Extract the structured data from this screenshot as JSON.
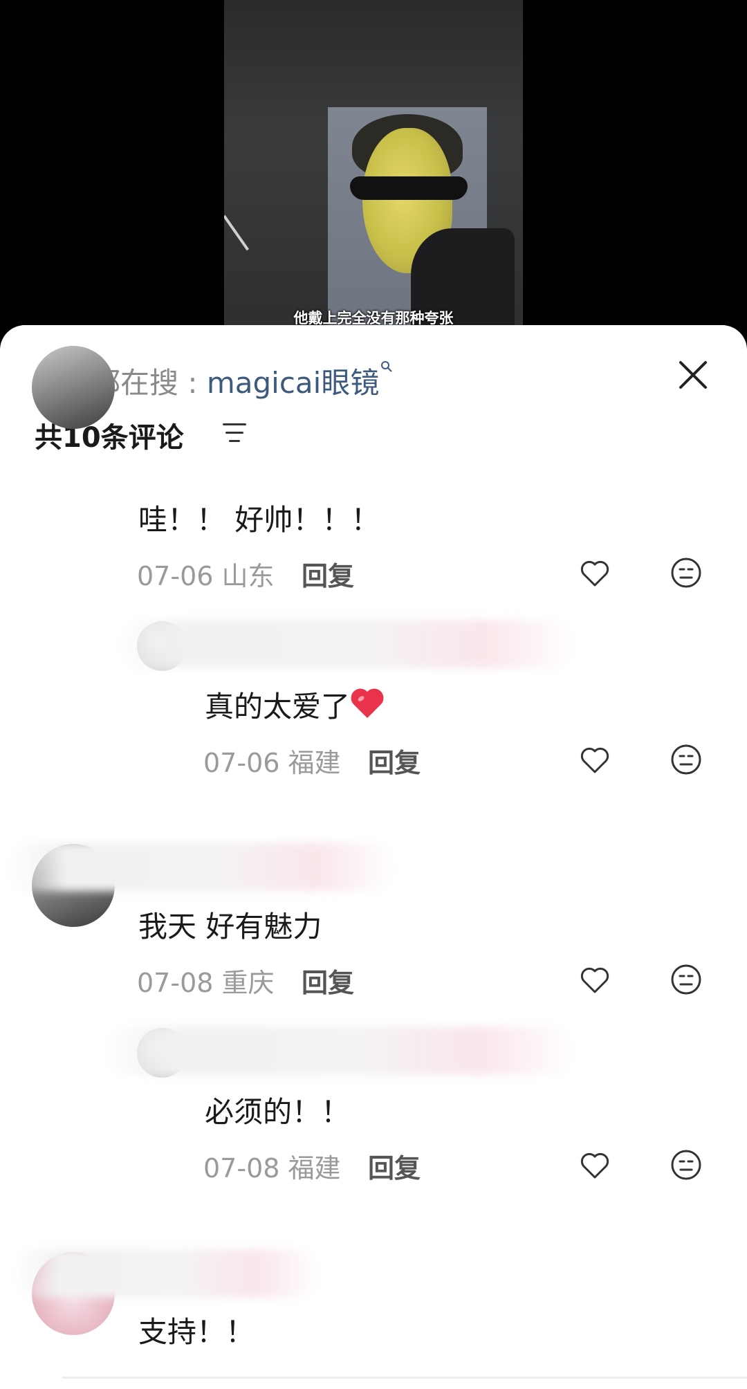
{
  "video": {
    "caption": "他戴上完全没有那种夸张"
  },
  "sheet": {
    "search_prefix": "大家都在搜 : ",
    "search_keyword": "magicai眼镜",
    "comment_count": "共10条评论"
  },
  "comments": [
    {
      "text": "哇！！ 好帅！！！",
      "date": "07-06",
      "location": "山东",
      "reply": "回复"
    },
    {
      "text": "真的太爱了",
      "date": "07-06",
      "location": "福建",
      "reply": "回复"
    },
    {
      "text": "我天 好有魅力",
      "date": "07-08",
      "location": "重庆",
      "reply": "回复"
    },
    {
      "text": "必须的！！",
      "date": "07-08",
      "location": "福建",
      "reply": "回复"
    },
    {
      "text": "支持！！"
    }
  ],
  "icons": {
    "close": "close-icon",
    "filter": "filter-icon",
    "like": "heart-outline-icon",
    "dislike": "meh-face-icon",
    "search": "search-icon",
    "heart_emoji": "red-heart-emoji"
  },
  "colors": {
    "keyword": "#3d5a7d",
    "meta": "#9a9a9a",
    "heart": "#e8334a"
  }
}
